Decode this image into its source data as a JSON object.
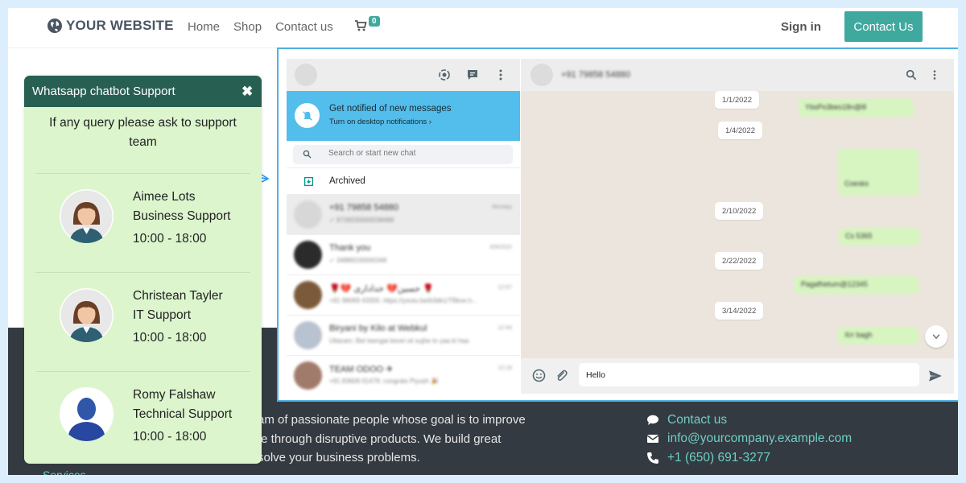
{
  "header": {
    "logo_text": "YOUR WEBSITE",
    "nav": [
      "Home",
      "Shop",
      "Contact us"
    ],
    "cart_count": "0",
    "sign_in": "Sign in",
    "contact_button": "Contact Us"
  },
  "footer": {
    "about_lines": [
      "am of passionate people whose goal is to improve",
      "fe through disruptive products. We build great",
      "solve your business problems."
    ],
    "contact_link": "Contact us",
    "email": "info@yourcompany.example.com",
    "phone": "+1 (650) 691-3277",
    "services_link": "Services"
  },
  "widget": {
    "title": "Whatsapp chatbot Support",
    "close_symbol": "✖",
    "intro": "If any query please ask to support team",
    "agents": [
      {
        "name": "Aimee Lots",
        "role": "Business Support",
        "hours": "10:00 - 18:00"
      },
      {
        "name": "Christean Tayler",
        "role": "IT Support",
        "hours": "10:00 - 18:00"
      },
      {
        "name": "Romy Falshaw",
        "role": "Technical Support",
        "hours": "10:00 - 18:00"
      }
    ]
  },
  "whatsapp": {
    "notification": {
      "title": "Get notified of new messages",
      "subtitle": "Turn on desktop notifications ›"
    },
    "search_placeholder": "Search or start new chat",
    "archived_label": "Archived",
    "chats": [
      {
        "name": "+91 79858 54880",
        "preview": "✓ 9726530000038489",
        "time": "Monday"
      },
      {
        "name": "Thank you",
        "preview": "✓ 34889100000349",
        "time": "6/9/2022"
      },
      {
        "name": "🌹💔 حسین💔 خداداری 🌹",
        "preview": "+91 98069 43305: https://youtu.be/b3dk1/TBkve.h...",
        "time": "12:57"
      },
      {
        "name": "Biryani by Kilo at Webkul",
        "preview": "Uttaram: Bet teengai kevei oii sujhe to yaa ki haa",
        "time": "12:44"
      },
      {
        "name": "TEAM ODOO ✈",
        "preview": "+91 83609 01479: congrats Piyush 🎉",
        "time": "12:18"
      }
    ],
    "contact_header": "+91 79858 54880",
    "dates": [
      "1/1/2022",
      "1/4/2022",
      "2/10/2022",
      "2/22/2022",
      "3/14/2022"
    ],
    "messages": [
      "YbsPo3bes18n@lll",
      "Coesks",
      "Cs 5365",
      "Pagafhetum@12345",
      "Xrr bagh"
    ],
    "composer_text": "Hello"
  },
  "colors": {
    "brand_teal": "#3fa9a0",
    "widget_header": "#285f53",
    "widget_bg": "#dcf5cd",
    "whatsapp_notify": "#53bdeb",
    "footer_bg": "#343a41",
    "frame_border": "#4fb1e4"
  }
}
